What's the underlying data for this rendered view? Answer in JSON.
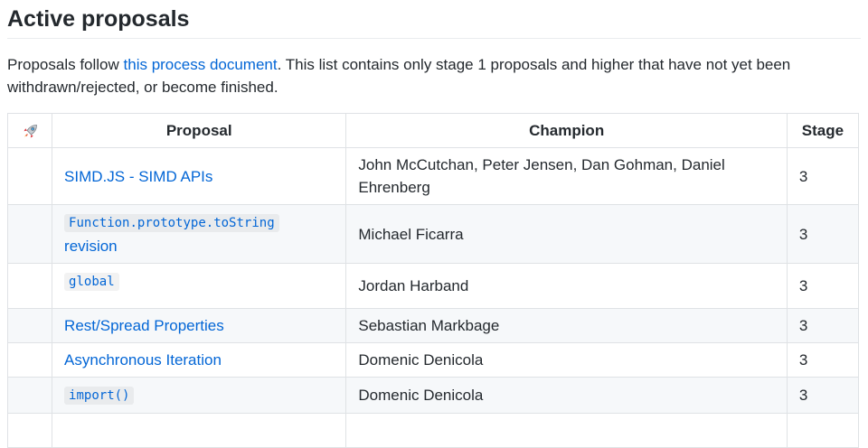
{
  "heading": "Active proposals",
  "intro": {
    "prefix": "Proposals follow ",
    "link": "this process document",
    "suffix": ". This list contains only stage 1 proposals and higher that have not yet been withdrawn/rejected, or become finished."
  },
  "table": {
    "icon": "rocket-icon",
    "headers": {
      "proposal": "Proposal",
      "champion": "Champion",
      "stage": "Stage"
    },
    "rows": [
      {
        "proposal": "SIMD.JS - SIMD APIs",
        "code": "",
        "suffix": "",
        "champion": "John McCutchan, Peter Jensen, Dan Gohman, Daniel Ehrenberg",
        "stage": "3"
      },
      {
        "proposal": "",
        "code": "Function.prototype.toString",
        "suffix": "revision",
        "champion": "Michael Ficarra",
        "stage": "3"
      },
      {
        "proposal": "",
        "code": "global",
        "suffix": "",
        "champion": "Jordan Harband",
        "stage": "3"
      },
      {
        "proposal": "Rest/Spread Properties",
        "code": "",
        "suffix": "",
        "champion": "Sebastian Markbage",
        "stage": "3"
      },
      {
        "proposal": "Asynchronous Iteration",
        "code": "",
        "suffix": "",
        "champion": "Domenic Denicola",
        "stage": "3"
      },
      {
        "proposal": "",
        "code": "import()",
        "suffix": "",
        "champion": "Domenic Denicola",
        "stage": "3"
      }
    ]
  }
}
